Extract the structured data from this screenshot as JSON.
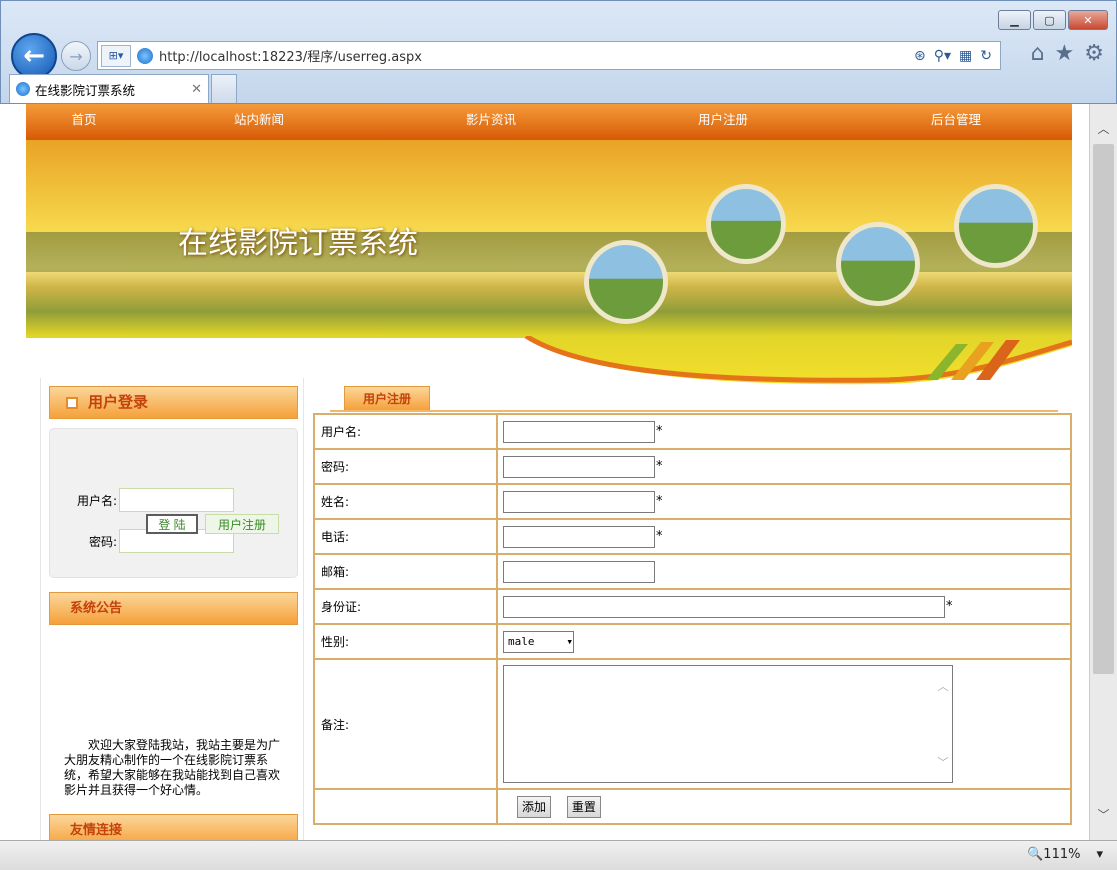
{
  "browser": {
    "url": "http://localhost:18223/程序/userreg.aspx",
    "tab_title": "在线影院订票系统",
    "zoom": "111%"
  },
  "nav": [
    "首页",
    "站内新闻",
    "影片资讯",
    "用户注册",
    "后台管理"
  ],
  "banner": {
    "title": "在线影院订票系统"
  },
  "sidebar": {
    "login_title": "用户登录",
    "username_label": "用户名:",
    "password_label": "密码:",
    "login_button": "登 陆",
    "register_button": "用户注册",
    "notice_title": "系统公告",
    "notice_text": "欢迎大家登陆我站，我站主要是为广大朋友精心制作的一个在线影院订票系统，希望大家能够在我站能找到自己喜欢影片并且获得一个好心情。",
    "links_title": "友情连接"
  },
  "form": {
    "tab_label": "用户注册",
    "fields": [
      {
        "label": "用户名:",
        "required": "*"
      },
      {
        "label": "密码:",
        "required": "*"
      },
      {
        "label": "姓名:",
        "required": "*"
      },
      {
        "label": "电话:",
        "required": "*"
      },
      {
        "label": "邮箱:",
        "required": ""
      },
      {
        "label": "身份证:",
        "required": "*"
      }
    ],
    "gender_label": "性别:",
    "gender_value": "male",
    "remark_label": "备注:",
    "add_button": "添加",
    "reset_button": "重置"
  }
}
